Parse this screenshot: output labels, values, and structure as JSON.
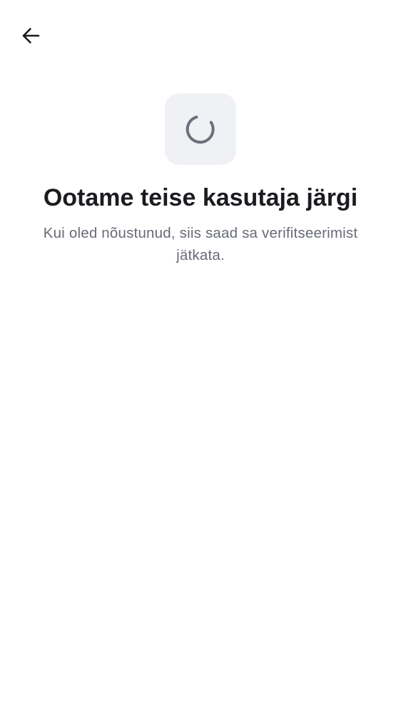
{
  "colors": {
    "background": "#ffffff",
    "title": "#1b1c20",
    "subtitle": "#676b76",
    "icon": "#1b1c20",
    "spinner": "#6b707b",
    "spinner_box": "#f0f1f5"
  },
  "header": {
    "back_icon": "arrow-left-icon"
  },
  "status": {
    "icon": "loading-spinner-icon",
    "title": "Ootame teise kasutaja järgi",
    "message": "Kui oled nõustunud, siis saad sa verifitseerimist jätkata."
  }
}
